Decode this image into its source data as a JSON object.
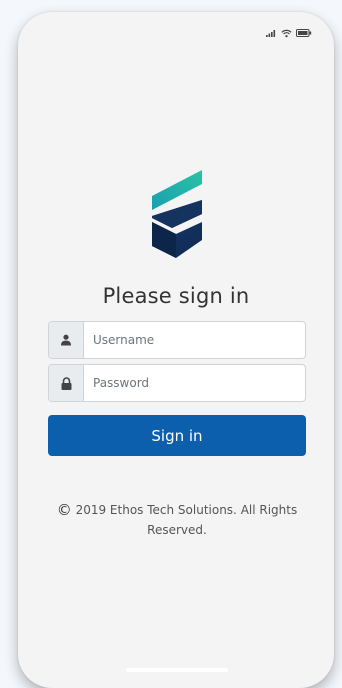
{
  "status_bar": {
    "icons": [
      "signal-icon",
      "wifi-icon",
      "battery-icon"
    ]
  },
  "brand": {
    "logo": "ethos-logo",
    "colors": {
      "teal": "#1fb3a8",
      "navy": "#13315e",
      "accent": "#0b5fac"
    }
  },
  "login": {
    "title": "Please sign in",
    "username": {
      "icon": "user-icon",
      "placeholder": "Username",
      "value": ""
    },
    "password": {
      "icon": "lock-icon",
      "placeholder": "Password",
      "value": ""
    },
    "submit_label": "Sign in"
  },
  "footer": {
    "copyright_symbol": "©",
    "text": "2019 Ethos Tech Solutions. All Rights Reserved."
  }
}
